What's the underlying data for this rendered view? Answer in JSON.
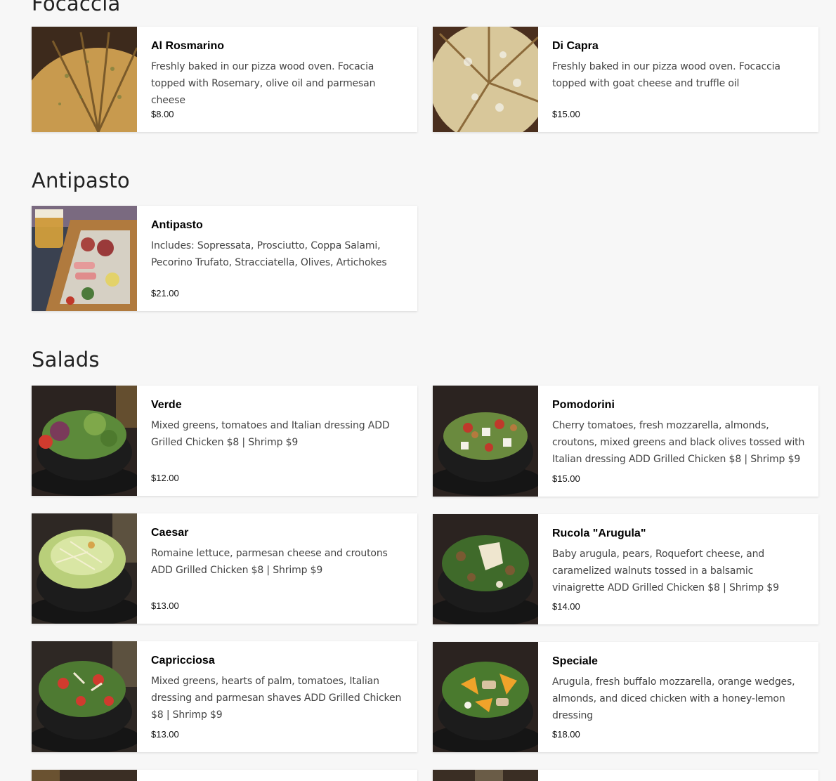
{
  "sections": [
    {
      "title": "Focaccia"
    },
    {
      "title": "Antipasto"
    },
    {
      "title": "Salads"
    }
  ],
  "items": [
    {
      "name": "Al Rosmarino",
      "description": "Freshly baked in our pizza wood oven. Focacia topped with Rosemary, olive oil and parmesan cheese",
      "price": "$8.00",
      "image": "focaccia-rosemary-photo"
    },
    {
      "name": "Di Capra",
      "description": "Freshly baked in our pizza wood oven. Focaccia topped with goat cheese and truffle oil",
      "price": "$15.00",
      "image": "focaccia-goat-cheese-photo"
    },
    {
      "name": "Antipasto",
      "description": "Includes: Sopressata, Prosciutto, Coppa Salami, Pecorino Trufato, Stracciatella, Olives, Artichokes",
      "price": "$21.00",
      "image": "antipasto-board-photo"
    },
    {
      "name": "Verde",
      "description": "Mixed greens, tomatoes and Italian dressing ADD Grilled Chicken $8 | Shrimp $9",
      "price": "$12.00",
      "image": "salad-bowl-photo"
    },
    {
      "name": "Pomodorini",
      "description": "Cherry tomatoes, fresh mozzarella, almonds, croutons, mixed greens and black olives tossed with Italian dressing ADD Grilled Chicken $8 | Shrimp $9",
      "price": "$15.00",
      "image": "salad-bowl-photo"
    },
    {
      "name": "Caesar",
      "description": "Romaine lettuce, parmesan cheese and croutons ADD Grilled Chicken $8 | Shrimp $9",
      "price": "$13.00",
      "image": "salad-bowl-photo"
    },
    {
      "name": "Rucola \"Arugula\"",
      "description": "Baby arugula, pears, Roquefort cheese, and caramelized walnuts tossed in a balsamic vinaigrette ADD Grilled Chicken $8 | Shrimp $9",
      "price": "$14.00",
      "image": "salad-bowl-photo"
    },
    {
      "name": "Capricciosa",
      "description": "Mixed greens, hearts of palm, tomatoes, Italian dressing and parmesan shaves ADD Grilled Chicken $8 | Shrimp $9",
      "price": "$13.00",
      "image": "salad-bowl-photo"
    },
    {
      "name": "Speciale",
      "description": "Arugula, fresh buffalo mozzarella, orange wedges, almonds, and diced chicken with a honey-lemon dressing",
      "price": "$18.00",
      "image": "salad-bowl-photo"
    }
  ],
  "colors": {
    "page_background": "#f7f7f7",
    "card_background": "#ffffff",
    "description_text": "#444444"
  }
}
